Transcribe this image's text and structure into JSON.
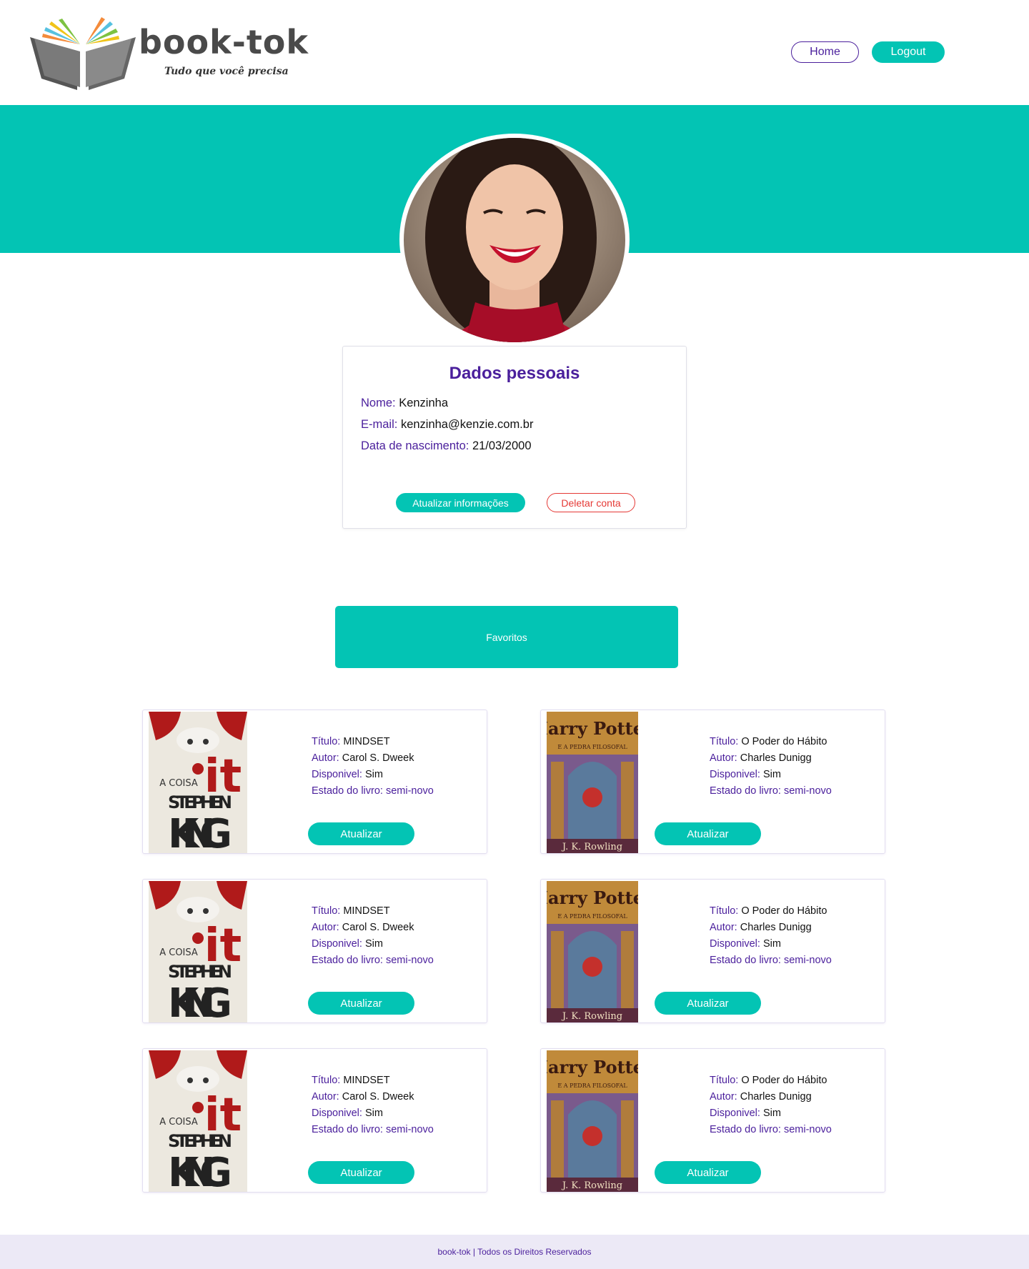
{
  "header": {
    "logo_title": "book-tok",
    "logo_tagline": "Tudo que você precisa",
    "nav": {
      "home_label": "Home",
      "logout_label": "Logout"
    }
  },
  "colors": {
    "accent": "#03c4b4",
    "brand_purple": "#4a1f9c",
    "danger": "#e53935",
    "footer_bg": "#ece9f6"
  },
  "profile": {
    "title": "Dados pessoais",
    "name_label": "Nome:",
    "name_value": "Kenzinha",
    "email_label": "E-mail:",
    "email_value": "kenzinha@kenzie.com.br",
    "birth_label": "Data de nascimento:",
    "birth_value": "21/03/2000",
    "update_button": "Atualizar informações",
    "delete_button": "Deletar conta"
  },
  "favorites": {
    "label": "Favoritos"
  },
  "books": [
    {
      "title_label": "Título:",
      "title": "MINDSET",
      "author_label": "Autor:",
      "author": "Carol S. Dweek",
      "available_label": "Disponivel:",
      "available": "Sim",
      "status_label": "Estado do livro:",
      "status": "semi-novo",
      "button": "Atualizar",
      "cover": "it-stephen-king",
      "cover_text": {
        "top": "A COISA",
        "author_first": "STEPHEN",
        "author_last": "KING",
        "big": "it"
      }
    },
    {
      "title_label": "Título:",
      "title": "O Poder do Hábito",
      "author_label": "Autor:",
      "author": "Charles Dunigg",
      "available_label": "Disponivel:",
      "available": "Sim",
      "status_label": "Estado do livro:",
      "status": "semi-novo",
      "button": "Atualizar",
      "cover": "harry-potter",
      "cover_text": {
        "title": "Harry Potter",
        "subtitle": "E A PEDRA FILOSOFAL",
        "author": "J. K. Rowling"
      }
    },
    {
      "title_label": "Título:",
      "title": "MINDSET",
      "author_label": "Autor:",
      "author": "Carol S. Dweek",
      "available_label": "Disponivel:",
      "available": "Sim",
      "status_label": "Estado do livro:",
      "status": "semi-novo",
      "button": "Atualizar",
      "cover": "it-stephen-king",
      "cover_text": {
        "top": "A COISA",
        "author_first": "STEPHEN",
        "author_last": "KING",
        "big": "it"
      }
    },
    {
      "title_label": "Título:",
      "title": "O Poder do Hábito",
      "author_label": "Autor:",
      "author": "Charles Dunigg",
      "available_label": "Disponivel:",
      "available": "Sim",
      "status_label": "Estado do livro:",
      "status": "semi-novo",
      "button": "Atualizar",
      "cover": "harry-potter",
      "cover_text": {
        "title": "Harry Potter",
        "subtitle": "E A PEDRA FILOSOFAL",
        "author": "J. K. Rowling"
      }
    },
    {
      "title_label": "Título:",
      "title": "MINDSET",
      "author_label": "Autor:",
      "author": "Carol S. Dweek",
      "available_label": "Disponivel:",
      "available": "Sim",
      "status_label": "Estado do livro:",
      "status": "semi-novo",
      "button": "Atualizar",
      "cover": "it-stephen-king",
      "cover_text": {
        "top": "A COISA",
        "author_first": "STEPHEN",
        "author_last": "KING",
        "big": "it"
      }
    },
    {
      "title_label": "Título:",
      "title": "O Poder do Hábito",
      "author_label": "Autor:",
      "author": "Charles Dunigg",
      "available_label": "Disponivel:",
      "available": "Sim",
      "status_label": "Estado do livro:",
      "status": "semi-novo",
      "button": "Atualizar",
      "cover": "harry-potter",
      "cover_text": {
        "title": "Harry Potter",
        "subtitle": "E A PEDRA FILOSOFAL",
        "author": "J. K. Rowling"
      }
    }
  ],
  "footer": {
    "text": "book-tok | Todos os Direitos Reservados"
  }
}
